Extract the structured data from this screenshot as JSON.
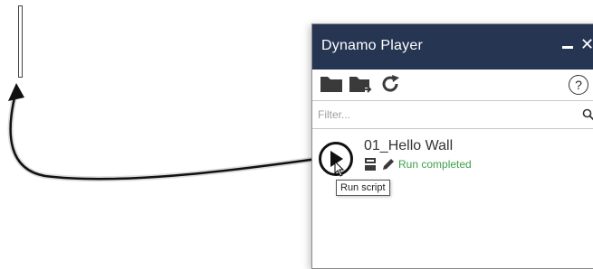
{
  "panel": {
    "title": "Dynamo Player",
    "minimize_label": "–",
    "close_label": "✕",
    "help_label": "?",
    "toolbar": {
      "open_folder_icon": "folder-icon",
      "export_icon": "folder-export-icon",
      "refresh_icon": "refresh-icon"
    },
    "filter": {
      "placeholder": "Filter...",
      "value": ""
    },
    "scripts": [
      {
        "name": "01_Hello Wall",
        "status": "Run completed",
        "tooltip": "Run script"
      }
    ]
  },
  "colors": {
    "titlebar": "#263552",
    "status": "#3ea14b"
  }
}
